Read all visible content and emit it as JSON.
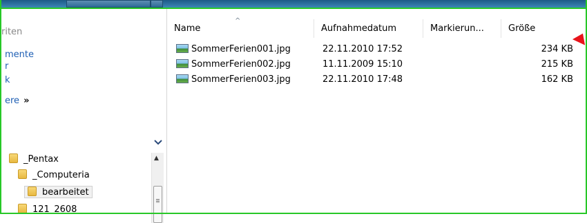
{
  "nav": {
    "favorites_partial": "riten",
    "documents_partial": "mente",
    "item3_partial": "r",
    "item4_partial": "k",
    "more_partial": "ere",
    "more_chevron": "»",
    "collapse_arrow": "⌄"
  },
  "tree": {
    "items": [
      {
        "label": "_Pentax"
      },
      {
        "label": "_Computeria"
      },
      {
        "label": "bearbeitet"
      },
      {
        "label": "121_2608"
      }
    ]
  },
  "columns": {
    "name": "Name",
    "date": "Aufnahmedatum",
    "tags": "Markierun...",
    "size": "Größe"
  },
  "sort_indicator": "^",
  "files": [
    {
      "name": "SommerFerien001.jpg",
      "date": "22.11.2010 17:52",
      "tags": "",
      "size": "234 KB"
    },
    {
      "name": "SommerFerien002.jpg",
      "date": "11.11.2009 15:10",
      "tags": "",
      "size": "215 KB"
    },
    {
      "name": "SommerFerien003.jpg",
      "date": "22.11.2010 17:48",
      "tags": "",
      "size": "162 KB"
    }
  ],
  "colors": {
    "accent_link": "#1e5fb4",
    "highlight_frame": "#27c827",
    "annotation_arrow": "#e8141b"
  }
}
